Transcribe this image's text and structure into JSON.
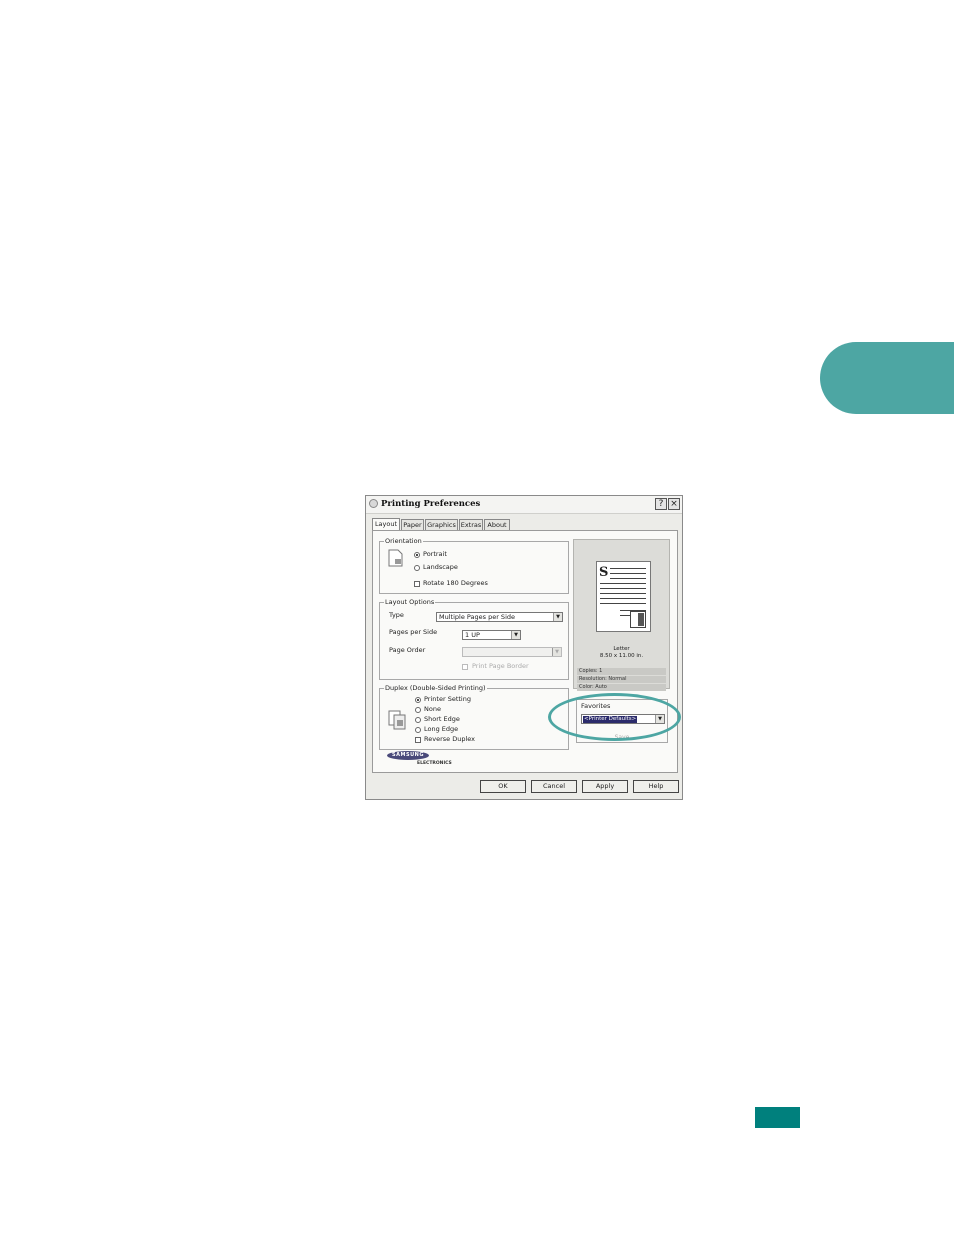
{
  "dialog": {
    "title": "Printing Preferences",
    "help_glyph": "?",
    "close_glyph": "×",
    "tabs": [
      {
        "label": "Layout"
      },
      {
        "label": "Paper"
      },
      {
        "label": "Graphics"
      },
      {
        "label": "Extras"
      },
      {
        "label": "About"
      }
    ],
    "orientation": {
      "legend": "Orientation",
      "portrait": "Portrait",
      "landscape": "Landscape",
      "rotate": "Rotate 180 Degrees",
      "selected": "Portrait"
    },
    "layout_options": {
      "legend": "Layout Options",
      "type_label": "Type",
      "type_value": "Multiple Pages per Side",
      "pages_per_side_label": "Pages per Side",
      "pages_per_side_value": "1 UP",
      "page_order_label": "Page Order",
      "page_order_value": "",
      "print_page_border": "Print Page Border"
    },
    "duplex": {
      "legend": "Duplex (Double-Sided Printing)",
      "printer_setting": "Printer Setting",
      "none": "None",
      "short_edge": "Short Edge",
      "long_edge": "Long Edge",
      "reverse_duplex": "Reverse Duplex",
      "selected": "Printer Setting"
    },
    "preview": {
      "big_letter": "S",
      "paper_name": "Letter",
      "paper_size": "8.50 x 11.00 in.",
      "copies": "Copies: 1",
      "resolution": "Resolution: Normal",
      "color": "Color: Auto"
    },
    "favorites": {
      "legend": "Favorites",
      "value": "<Printer Defaults>",
      "save_label": "Save"
    },
    "logo": {
      "brand": "SAMSUNG",
      "sub": "ELECTRONICS"
    },
    "buttons": {
      "ok": "OK",
      "cancel": "Cancel",
      "apply": "Apply",
      "help": "Help"
    }
  },
  "colors": {
    "accent_teal": "#4da6a3",
    "page_marker": "#00807d"
  }
}
